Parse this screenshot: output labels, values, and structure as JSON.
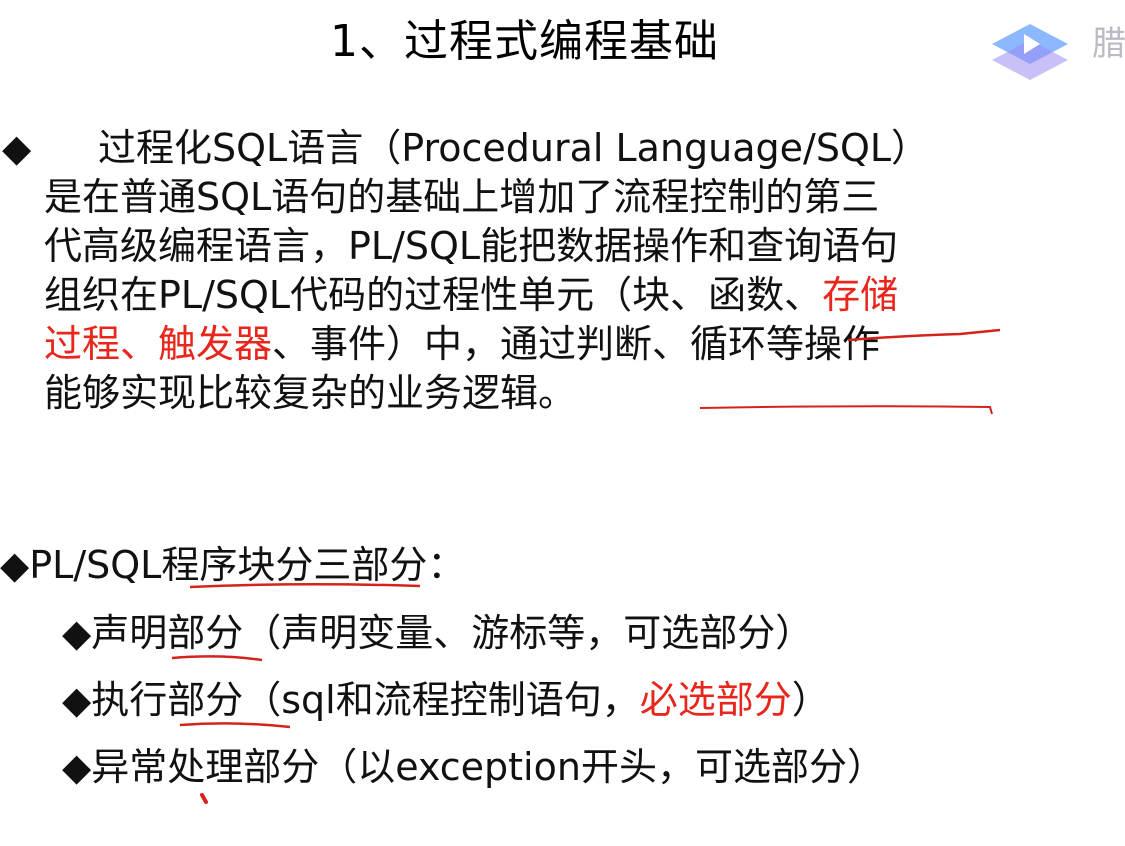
{
  "slide": {
    "title": "1、过程式编程基础",
    "logo_text": "腊",
    "bullet_symbol": "◆",
    "para_lines": [
      "过程化SQL语言（Procedural Language/SQL）",
      "是在普通SQL语句的基础上增加了流程控制的第三",
      "代高级编程语言，PL/SQL能把数据操作和查询语句",
      "组织在PL/SQL代码的过程性单元（块、函数、",
      "存储",
      "过程、触发器",
      "、事件）中，通过判断、循环等操作",
      "能够实现比较复杂的业务逻辑。"
    ],
    "section_title": "PL/SQL程序块分三部分：",
    "parts": [
      {
        "bullet": "◆",
        "text": "声明部分（声明变量、游标等，可选部分）"
      },
      {
        "bullet": "◆",
        "pre": "执行部分（sql和流程控制语句，",
        "red": "必选部分",
        "post": "）"
      },
      {
        "bullet": "◆",
        "text": "异常处理部分（以exception开头，可选部分）"
      }
    ],
    "colors": {
      "highlight": "#e8261c",
      "annotation": "#d4231b",
      "logo_blue": "#5b8ff9"
    }
  }
}
